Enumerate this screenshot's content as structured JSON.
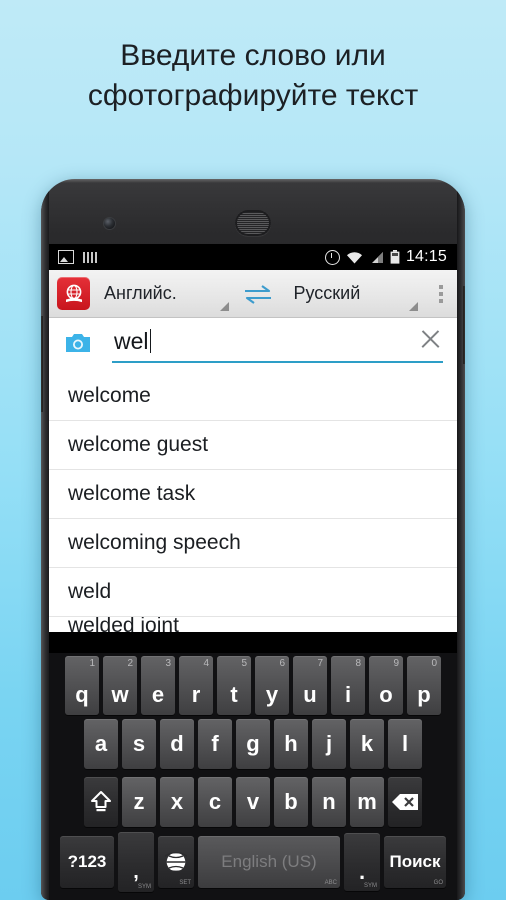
{
  "promo": {
    "line1": "Введите слово или",
    "line2": "сфотографируйте текст",
    "bg_top": "#bfeaf7",
    "bg_bottom": "#6ccdf0"
  },
  "statusbar": {
    "icons_left": [
      "screenshot-icon",
      "keyboard-icon"
    ],
    "icons_right": [
      "alarm-icon",
      "wifi-icon",
      "signal-icon",
      "battery-icon"
    ],
    "time": "14:15"
  },
  "toolbar": {
    "app_icon": "dictionary-globe-icon",
    "source_language": "Английс.",
    "target_language": "Русский",
    "swap_icon": "swap-arrows-icon",
    "overflow_icon": "overflow-menu-icon",
    "accent": "#c8151d"
  },
  "search": {
    "camera_icon": "camera-icon",
    "value": "wel",
    "placeholder": "",
    "clear_icon": "clear-x-icon",
    "underline_color": "#2d9ec7"
  },
  "suggestions": [
    "welcome",
    "welcome guest",
    "welcome task",
    "welcoming speech",
    "weld",
    "welded joint"
  ],
  "keyboard": {
    "row1": [
      {
        "key": "q",
        "hint": "1"
      },
      {
        "key": "w",
        "hint": "2"
      },
      {
        "key": "e",
        "hint": "3"
      },
      {
        "key": "r",
        "hint": "4"
      },
      {
        "key": "t",
        "hint": "5"
      },
      {
        "key": "y",
        "hint": "6"
      },
      {
        "key": "u",
        "hint": "7"
      },
      {
        "key": "i",
        "hint": "8"
      },
      {
        "key": "o",
        "hint": "9"
      },
      {
        "key": "p",
        "hint": "0"
      }
    ],
    "row2": [
      "a",
      "s",
      "d",
      "f",
      "g",
      "h",
      "j",
      "k",
      "l"
    ],
    "row3_letters": [
      "z",
      "x",
      "c",
      "v",
      "b",
      "n",
      "m"
    ],
    "shift_icon": "shift-arrow-icon",
    "delete_icon": "backspace-icon",
    "symbols_label": "?123",
    "comma_label": ",",
    "globe_icon": "language-globe-icon",
    "space_label": "English (US)",
    "period_label": ".",
    "enter_label": "Поиск"
  }
}
